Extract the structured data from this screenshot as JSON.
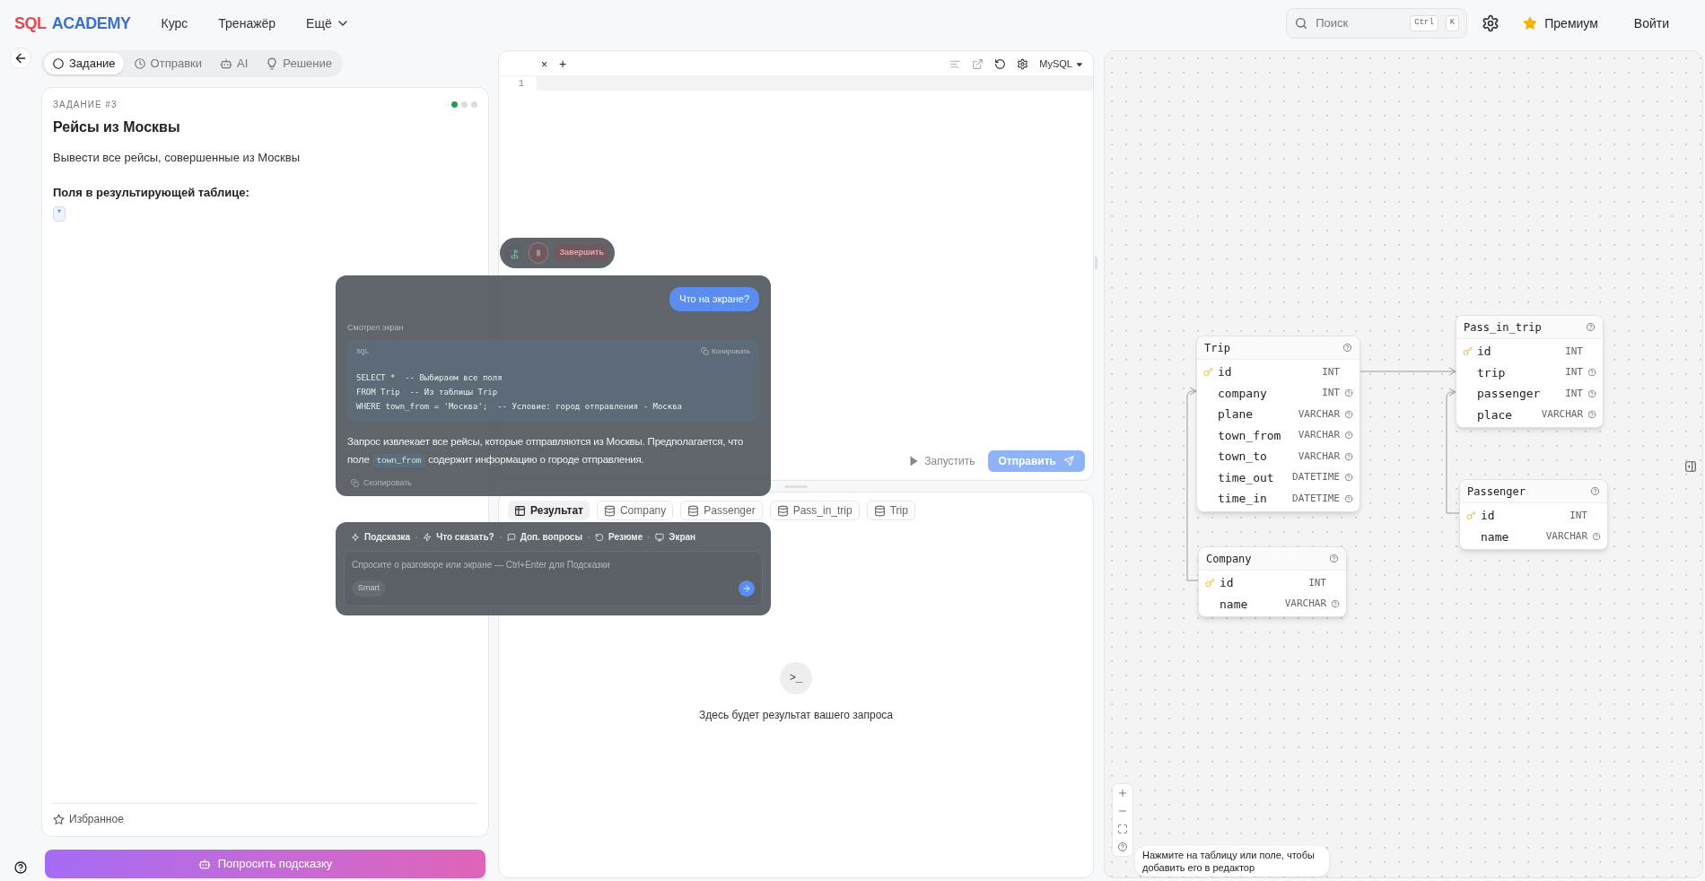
{
  "header": {
    "logo": [
      "SQL",
      "ACADEMY"
    ],
    "nav": [
      {
        "label": "Курс",
        "kind": "link"
      },
      {
        "label": "Тренажёр",
        "kind": "link"
      },
      {
        "label": "Ещё",
        "kind": "menu"
      }
    ],
    "search": {
      "placeholder": "Поиск",
      "keys": [
        "Ctrl",
        "K"
      ]
    },
    "premium": "Премиум",
    "login": "Войти"
  },
  "task_tabs": [
    {
      "label": "Задание",
      "selected": true
    },
    {
      "label": "Отправки",
      "selected": false
    },
    {
      "label": "AI",
      "selected": false
    },
    {
      "label": "Решение",
      "selected": false
    }
  ],
  "task": {
    "label": "ЗАДАНИЕ #3",
    "title": "Рейсы из Москвы",
    "description": "Вывести все рейсы, совершенные из Москвы",
    "fields_heading": "Поля в результирующей таблице:",
    "fields": [
      "*"
    ],
    "progress": [
      {
        "done": true
      },
      {
        "done": false
      },
      {
        "done": false
      }
    ],
    "favorite": "Избранное"
  },
  "hint_button": "Попросить подсказку",
  "editor": {
    "tab_close": "×",
    "add_tab": "+",
    "line_numbers": [
      "1"
    ],
    "dialect": "MySQL",
    "run": "Запустить",
    "submit": "Отправить"
  },
  "results": {
    "tabs": [
      {
        "label": "Результат",
        "selected": true
      },
      {
        "label": "Company",
        "selected": false
      },
      {
        "label": "Passenger",
        "selected": false
      },
      {
        "label": "Pass_in_trip",
        "selected": false
      },
      {
        "label": "Trip",
        "selected": false
      }
    ],
    "empty_icon": ">_",
    "empty_text": "Здесь будет результат вашего запроса"
  },
  "schema": {
    "tables": [
      {
        "name": "Trip",
        "columns": [
          {
            "name": "id",
            "type": "INT",
            "primary_key": true
          },
          {
            "name": "company",
            "type": "INT",
            "primary_key": false
          },
          {
            "name": "plane",
            "type": "VARCHAR",
            "primary_key": false
          },
          {
            "name": "town_from",
            "type": "VARCHAR",
            "primary_key": false
          },
          {
            "name": "town_to",
            "type": "VARCHAR",
            "primary_key": false
          },
          {
            "name": "time_out",
            "type": "DATETIME",
            "primary_key": false
          },
          {
            "name": "time_in",
            "type": "DATETIME",
            "primary_key": false
          }
        ]
      },
      {
        "name": "Pass_in_trip",
        "columns": [
          {
            "name": "id",
            "type": "INT",
            "primary_key": true
          },
          {
            "name": "trip",
            "type": "INT",
            "primary_key": false
          },
          {
            "name": "passenger",
            "type": "INT",
            "primary_key": false
          },
          {
            "name": "place",
            "type": "VARCHAR",
            "primary_key": false
          }
        ]
      },
      {
        "name": "Passenger",
        "columns": [
          {
            "name": "id",
            "type": "INT",
            "primary_key": true
          },
          {
            "name": "name",
            "type": "VARCHAR",
            "primary_key": false
          }
        ]
      },
      {
        "name": "Company",
        "columns": [
          {
            "name": "id",
            "type": "INT",
            "primary_key": true
          },
          {
            "name": "name",
            "type": "VARCHAR",
            "primary_key": false
          }
        ]
      }
    ],
    "tooltip": "Нажмите на таблицу или поле, чтобы добавить его в редактор"
  },
  "assistant": {
    "finish": "Завершить",
    "user_message": "Что на экране?",
    "status": "Смотрел экран",
    "code": {
      "language": "SQL",
      "copy": "Копировать",
      "lines": [
        "SELECT *  -- Выбираем все поля",
        "FROM Trip  -- Из таблицы Trip",
        "WHERE town_from = 'Москва';  -- Условие: город отправления - Москва"
      ]
    },
    "answer": {
      "before": "Запрос извлекает все рейсы, которые отправляются из Москвы. Предполагается, что поле",
      "code": "town_from",
      "after": "содержит информацию о городе отправления."
    },
    "copy_answer": "Скопировать",
    "quick_actions": [
      "Подсказка",
      "Что сказать?",
      "Доп. вопросы",
      "Резюме",
      "Экран"
    ],
    "input": {
      "placeholder": "Спросите о разговоре или экране — Ctrl+Enter для Подсказки",
      "mode": "Smart"
    }
  }
}
